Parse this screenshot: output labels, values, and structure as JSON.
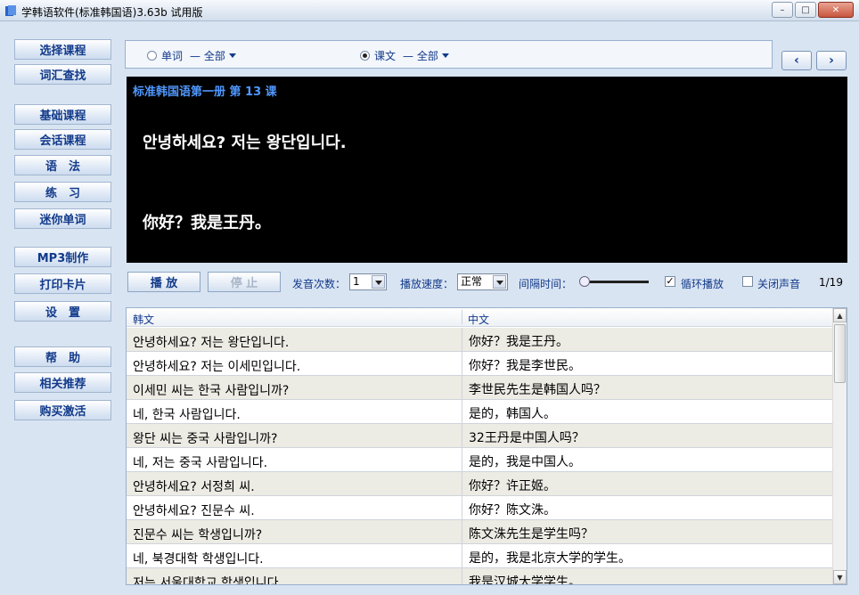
{
  "window": {
    "title": "学韩语软件(标准韩国语)3.63b 试用版",
    "buttons": {
      "minimize": "–",
      "maximize": "□",
      "close": "✕"
    }
  },
  "sidebar": {
    "groups": [
      [
        "选择课程",
        "词汇查找"
      ],
      [
        "基础课程",
        "会话课程",
        "语　法",
        "练　习",
        "迷你单词"
      ],
      [
        "MP3制作",
        "打印卡片",
        "设　置"
      ],
      [
        "帮　助",
        "相关推荐",
        "购买激活"
      ]
    ]
  },
  "mode": {
    "words_label": "单词",
    "words_filter": "— 全部",
    "words_selected": false,
    "text_label": "课文",
    "text_filter": "— 全部",
    "text_selected": true
  },
  "nav": {
    "prev": "‹",
    "next": "›"
  },
  "lesson": {
    "title": "标准韩国语第一册 第 13 课",
    "korean": "안녕하세요? 저는 왕단입니다.",
    "chinese": "你好？我是王丹。"
  },
  "controls": {
    "play": "播 放",
    "stop": "停 止",
    "repeat_label": "发音次数：",
    "repeat_value": "1",
    "speed_label": "播放速度：",
    "speed_value": "正常",
    "interval_label": "间隔时间：",
    "loop_label": "循环播放",
    "loop_checked": true,
    "mute_label": "关闭声音",
    "mute_checked": false,
    "position": "1/19"
  },
  "table": {
    "headers": [
      "韩文",
      "中文"
    ],
    "rows": [
      [
        "안녕하세요? 저는 왕단입니다.",
        "你好？我是王丹。"
      ],
      [
        "안녕하세요? 저는 이세민입니다.",
        "你好？我是李世民。"
      ],
      [
        "이세민 씨는 한국 사람입니까?",
        "李世民先生是韩国人吗？"
      ],
      [
        "네, 한국 사람입니다.",
        "是的，韩国人。"
      ],
      [
        "왕단 씨는 중국 사람입니까?",
        "32王丹是中国人吗？"
      ],
      [
        "네, 저는 중국 사람입니다.",
        "是的，我是中国人。"
      ],
      [
        "안녕하세요? 서정희 씨.",
        "你好？许正姬。"
      ],
      [
        "안녕하세요? 진문수 씨.",
        "你好？陈文洙。"
      ],
      [
        "진문수 씨는 학생입니까?",
        "陈文洙先生是学生吗？"
      ],
      [
        "네, 북경대학 학생입니다.",
        "是的，我是北京大学的学生。"
      ],
      [
        "저는 서울대학교 학생입니다.",
        "我是汉城大学学生。"
      ]
    ]
  }
}
